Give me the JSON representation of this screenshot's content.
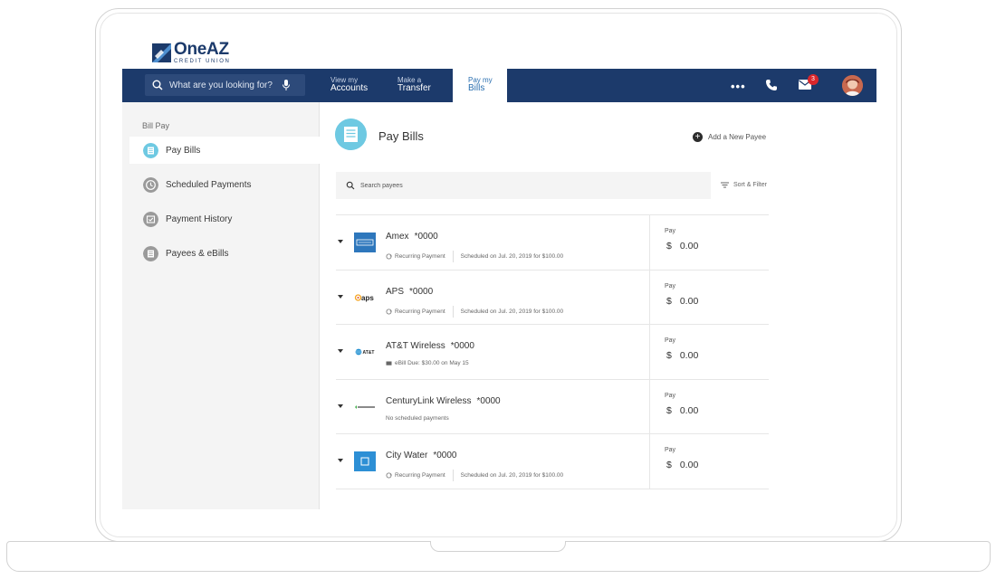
{
  "brand": {
    "name": "OneAZ",
    "subtitle": "CREDIT UNION",
    "navy": "#1c3a6b",
    "accent": "#6ec9e2"
  },
  "topnav": {
    "search_placeholder": "What are you looking for?",
    "links": [
      {
        "line1": "View my",
        "line2": "Accounts"
      },
      {
        "line1": "Make a",
        "line2": "Transfer"
      },
      {
        "line1": "Pay my",
        "line2": "Bills",
        "active": true
      }
    ],
    "more": "•••",
    "mail_badge": "3"
  },
  "sidebar": {
    "title": "Bill Pay",
    "items": [
      {
        "label": "Pay Bills",
        "icon": "pay-bills-icon",
        "active": true
      },
      {
        "label": "Scheduled Payments",
        "icon": "clock-icon"
      },
      {
        "label": "Payment History",
        "icon": "history-icon"
      },
      {
        "label": "Payees & eBills",
        "icon": "payees-icon"
      }
    ]
  },
  "main": {
    "title": "Pay Bills",
    "add_payee": "Add a New Payee",
    "search_placeholder": "Search payees",
    "sort_filter": "Sort & Filter",
    "payees": [
      {
        "name": "Amex",
        "account": "*0000",
        "logo": "amex",
        "meta1": "Recurring Payment",
        "meta2": "Scheduled on Jul. 20, 2019 for $100.00",
        "pay_label": "Pay",
        "currency": "$",
        "amount": "0.00"
      },
      {
        "name": "APS",
        "account": "*0000",
        "logo": "aps",
        "meta1": "Recurring Payment",
        "meta2": "Scheduled on Jul. 20, 2019 for $100.00",
        "pay_label": "Pay",
        "currency": "$",
        "amount": "0.00"
      },
      {
        "name": "AT&T Wireless",
        "account": "*0000",
        "logo": "att",
        "meta1": "eBill Due: $30.00 on May 15",
        "meta2": "",
        "pay_label": "Pay",
        "currency": "$",
        "amount": "0.00"
      },
      {
        "name": "CenturyLink Wireless",
        "account": "*0000",
        "logo": "centurylink",
        "meta1": "No scheduled payments",
        "meta2": "",
        "pay_label": "Pay",
        "currency": "$",
        "amount": "0.00"
      },
      {
        "name": "City Water",
        "account": "*0000",
        "logo": "citywater",
        "meta1": "Recurring Payment",
        "meta2": "Scheduled on Jul. 20, 2019 for $100.00",
        "pay_label": "Pay",
        "currency": "$",
        "amount": "0.00"
      }
    ]
  }
}
